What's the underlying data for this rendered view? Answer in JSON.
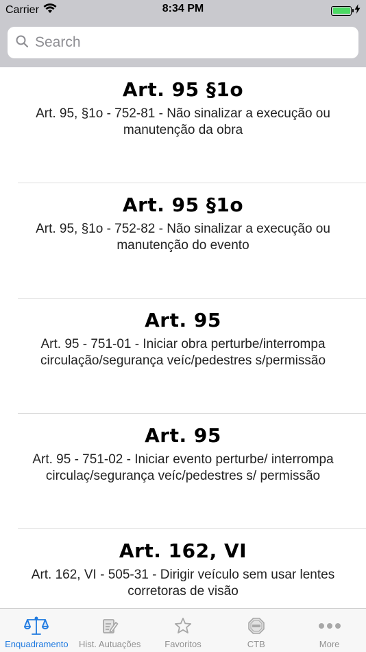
{
  "status_bar": {
    "carrier": "Carrier",
    "time": "8:34 PM",
    "battery_level": 1.0,
    "battery_color": "#4cd964"
  },
  "search": {
    "placeholder": "Search",
    "value": ""
  },
  "list": {
    "items": [
      {
        "title": "Art. 95 §1o",
        "description": "Art. 95, §1o - 752-81 - Não sinalizar a execução ou manutenção da obra"
      },
      {
        "title": "Art. 95 §1o",
        "description": "Art. 95, §1o - 752-82 - Não sinalizar a execução ou manutenção do evento"
      },
      {
        "title": "Art. 95",
        "description": "Art. 95 - 751-01 - Iniciar obra perturbe/interrompa circulação/segurança veíc/pedestres s/permissão"
      },
      {
        "title": "Art. 95",
        "description": "Art. 95 - 751-02 - Iniciar evento perturbe/ interrompa circulaç/segurança veíc/pedestres s/ permissão"
      },
      {
        "title": "Art. 162, VI",
        "description": "Art. 162, VI - 505-31 - Dirigir veículo sem usar lentes corretoras de visão"
      }
    ]
  },
  "tabbar": {
    "active_color": "#1f7ae0",
    "inactive_color": "#929292",
    "tabs": [
      {
        "label": "Enquadramento",
        "icon": "scales-icon",
        "active": true
      },
      {
        "label": "Hist. Autuações",
        "icon": "clipboard-edit-icon",
        "active": false
      },
      {
        "label": "Favoritos",
        "icon": "star-icon",
        "active": false
      },
      {
        "label": "CTB",
        "icon": "stop-sign-icon",
        "active": false
      },
      {
        "label": "More",
        "icon": "more-dots-icon",
        "active": false
      }
    ]
  }
}
